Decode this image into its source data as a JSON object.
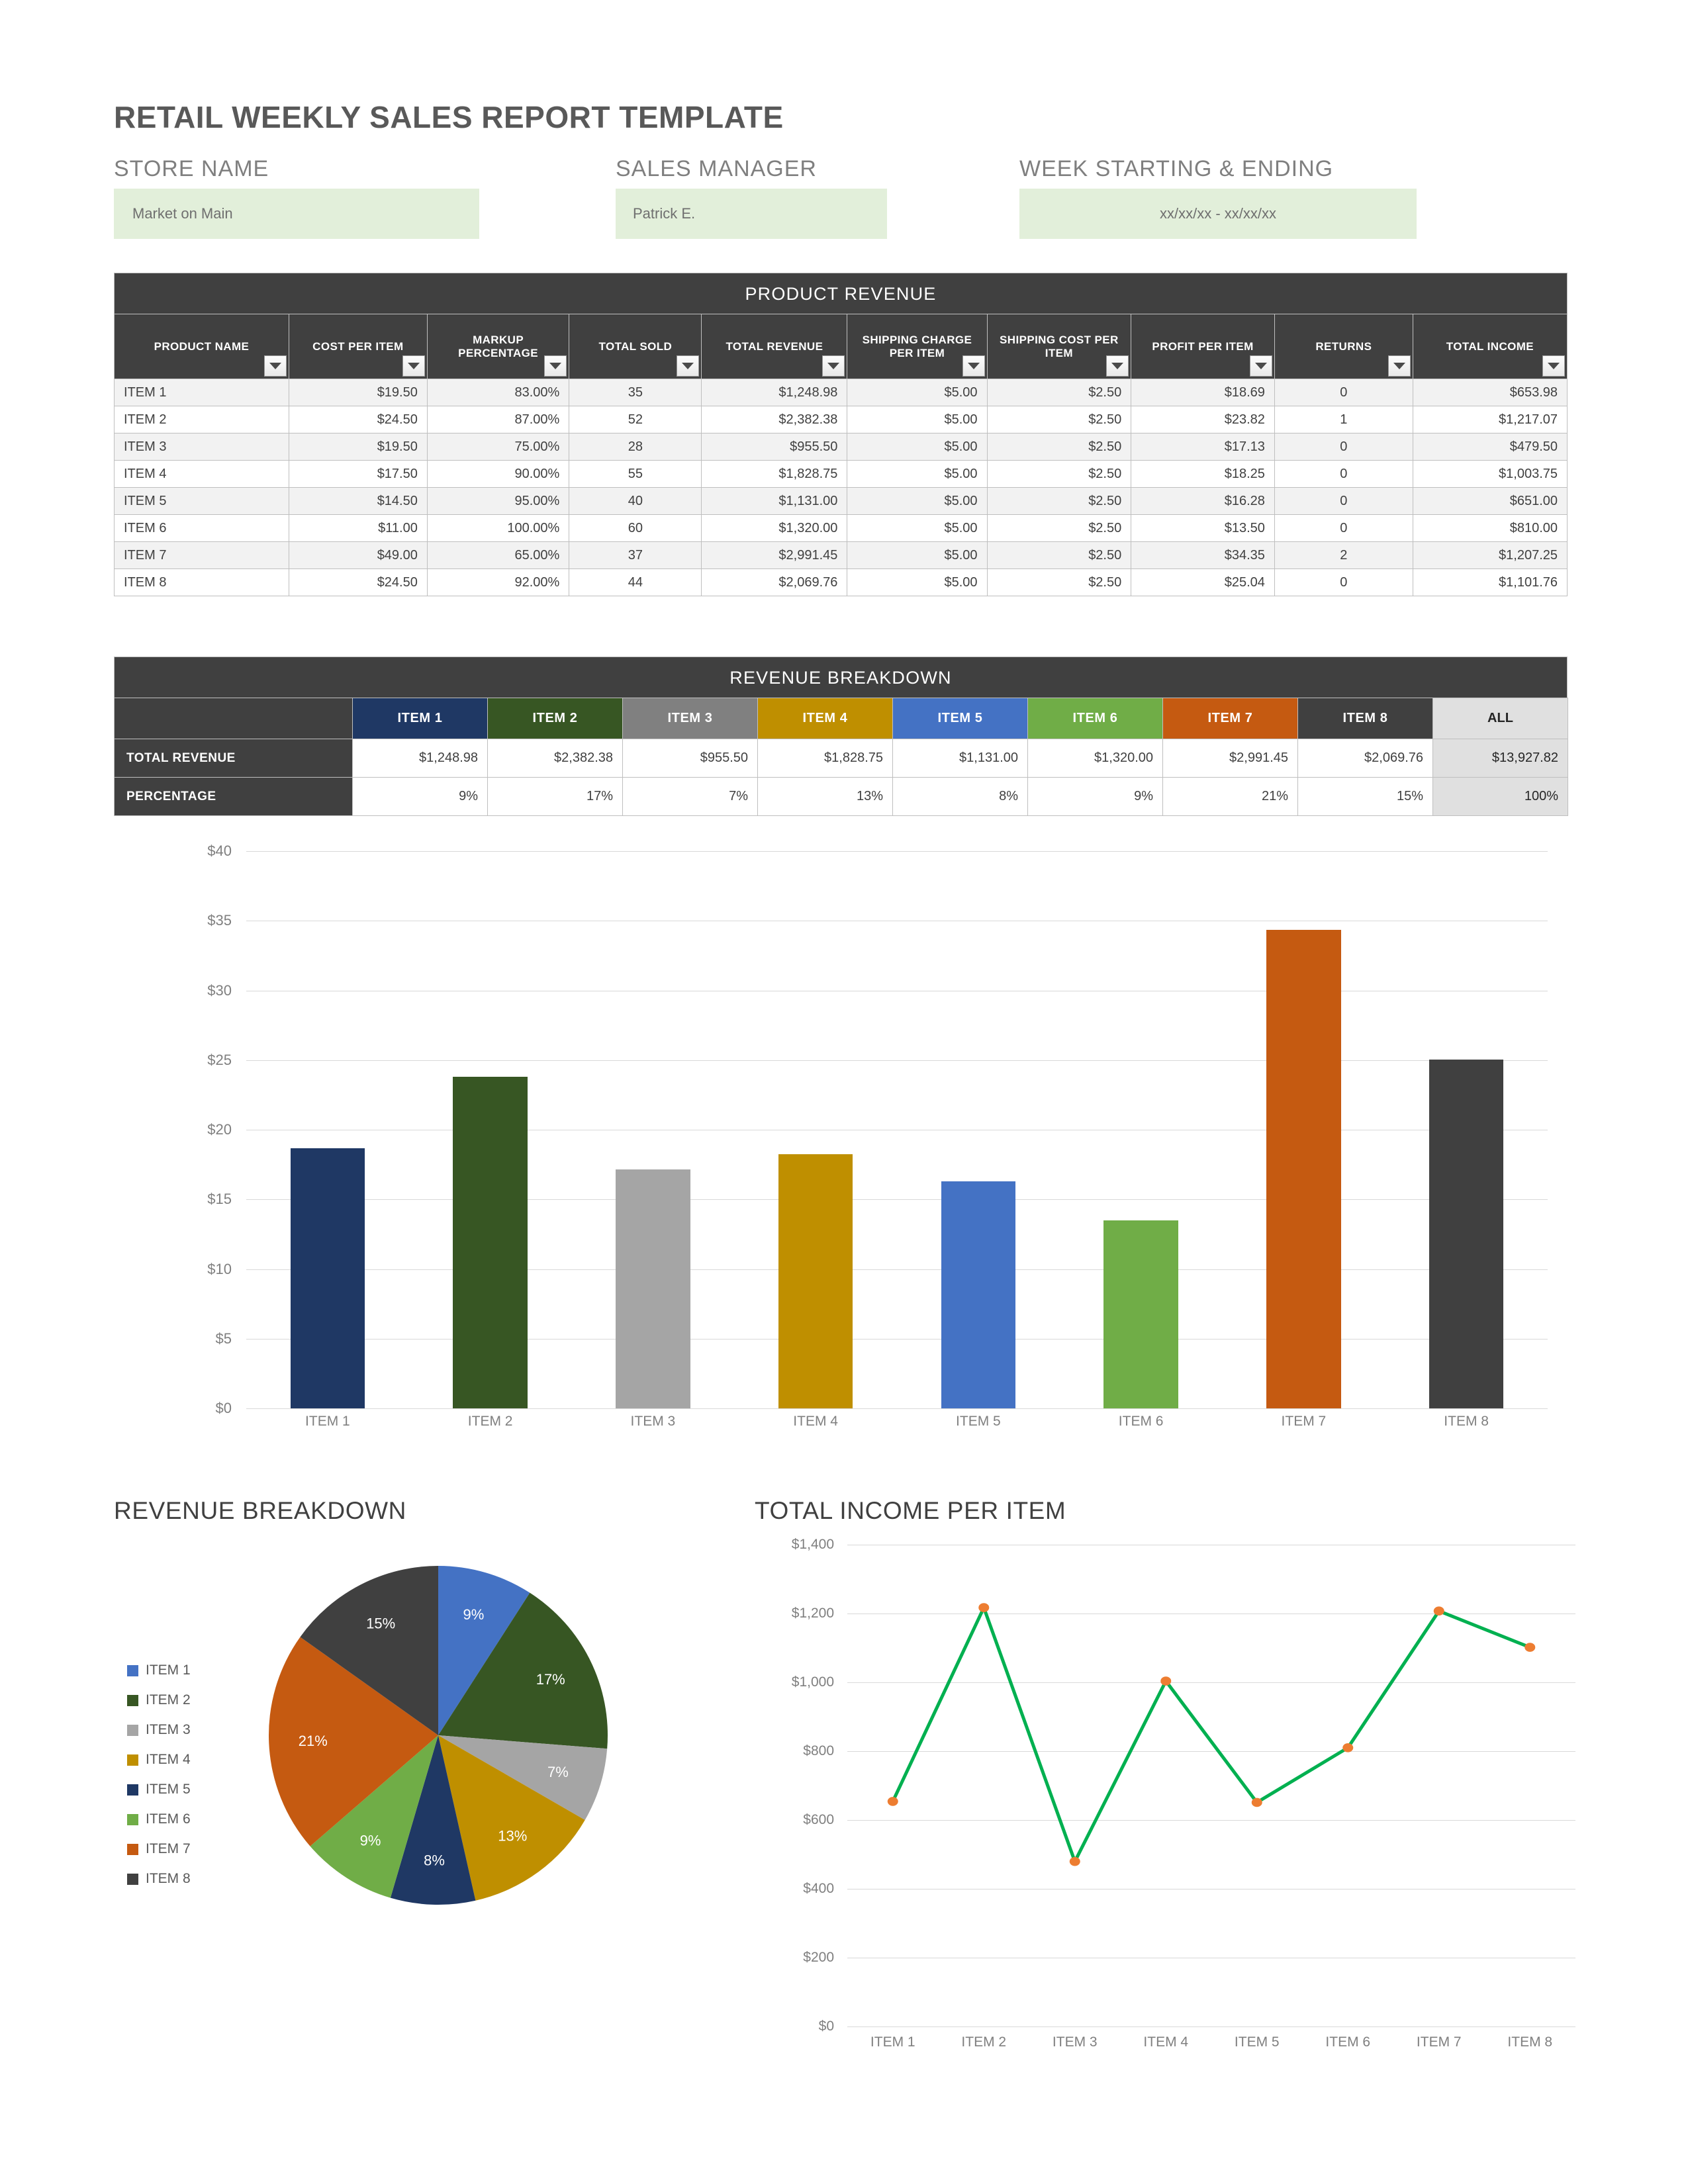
{
  "document": {
    "title": "RETAIL WEEKLY SALES REPORT TEMPLATE"
  },
  "header_fields": {
    "store": {
      "label": "STORE NAME",
      "value": "Market on Main"
    },
    "manager": {
      "label": "SALES MANAGER",
      "value": "Patrick E."
    },
    "week": {
      "label": "WEEK STARTING & ENDING",
      "value": "xx/xx/xx - xx/xx/xx"
    }
  },
  "product_revenue": {
    "band_title": "PRODUCT REVENUE",
    "columns": [
      "PRODUCT NAME",
      "COST PER ITEM",
      "MARKUP PERCENTAGE",
      "TOTAL SOLD",
      "TOTAL REVENUE",
      "SHIPPING CHARGE PER ITEM",
      "SHIPPING COST PER ITEM",
      "PROFIT PER ITEM",
      "RETURNS",
      "TOTAL INCOME"
    ],
    "rows": [
      [
        "ITEM 1",
        "$19.50",
        "83.00%",
        "35",
        "$1,248.98",
        "$5.00",
        "$2.50",
        "$18.69",
        "0",
        "$653.98"
      ],
      [
        "ITEM 2",
        "$24.50",
        "87.00%",
        "52",
        "$2,382.38",
        "$5.00",
        "$2.50",
        "$23.82",
        "1",
        "$1,217.07"
      ],
      [
        "ITEM 3",
        "$19.50",
        "75.00%",
        "28",
        "$955.50",
        "$5.00",
        "$2.50",
        "$17.13",
        "0",
        "$479.50"
      ],
      [
        "ITEM 4",
        "$17.50",
        "90.00%",
        "55",
        "$1,828.75",
        "$5.00",
        "$2.50",
        "$18.25",
        "0",
        "$1,003.75"
      ],
      [
        "ITEM 5",
        "$14.50",
        "95.00%",
        "40",
        "$1,131.00",
        "$5.00",
        "$2.50",
        "$16.28",
        "0",
        "$651.00"
      ],
      [
        "ITEM 6",
        "$11.00",
        "100.00%",
        "60",
        "$1,320.00",
        "$5.00",
        "$2.50",
        "$13.50",
        "0",
        "$810.00"
      ],
      [
        "ITEM 7",
        "$49.00",
        "65.00%",
        "37",
        "$2,991.45",
        "$5.00",
        "$2.50",
        "$34.35",
        "2",
        "$1,207.25"
      ],
      [
        "ITEM 8",
        "$24.50",
        "92.00%",
        "44",
        "$2,069.76",
        "$5.00",
        "$2.50",
        "$25.04",
        "0",
        "$1,101.76"
      ]
    ]
  },
  "revenue_breakdown_table": {
    "band_title": "REVENUE BREAKDOWN",
    "item_headers": [
      "ITEM 1",
      "ITEM 2",
      "ITEM 3",
      "ITEM 4",
      "ITEM 5",
      "ITEM 6",
      "ITEM 7",
      "ITEM 8"
    ],
    "all_header": "ALL",
    "header_colors": [
      "#1F3864",
      "#375623",
      "#808080",
      "#BF8F00",
      "#4472C4",
      "#70AD47",
      "#C55A11",
      "#404040"
    ],
    "rows": [
      {
        "label": "TOTAL REVENUE",
        "values": [
          "$1,248.98",
          "$2,382.38",
          "$955.50",
          "$1,828.75",
          "$1,131.00",
          "$1,320.00",
          "$2,991.45",
          "$2,069.76"
        ],
        "total": "$13,927.82"
      },
      {
        "label": "PERCENTAGE",
        "values": [
          "9%",
          "17%",
          "7%",
          "13%",
          "8%",
          "9%",
          "21%",
          "15%"
        ],
        "total": "100%"
      }
    ]
  },
  "chart_data": [
    {
      "type": "bar",
      "title": "",
      "xlabel": "",
      "ylabel": "",
      "categories": [
        "ITEM 1",
        "ITEM 2",
        "ITEM 3",
        "ITEM 4",
        "ITEM 5",
        "ITEM 6",
        "ITEM 7",
        "ITEM 8"
      ],
      "values": [
        18.69,
        23.82,
        17.13,
        18.25,
        16.28,
        13.5,
        34.35,
        25.04
      ],
      "colors": [
        "#1F3864",
        "#375623",
        "#A5A5A5",
        "#BF8F00",
        "#4472C4",
        "#70AD47",
        "#C55A11",
        "#404040"
      ],
      "ylim": [
        0,
        40
      ],
      "yticks": [
        "$0",
        "$5",
        "$10",
        "$15",
        "$20",
        "$25",
        "$30",
        "$35",
        "$40"
      ],
      "ytick_values": [
        0,
        5,
        10,
        15,
        20,
        25,
        30,
        35,
        40
      ],
      "grid": true,
      "legend": "none"
    },
    {
      "type": "pie",
      "title": "REVENUE BREAKDOWN",
      "labels": [
        "ITEM 1",
        "ITEM 2",
        "ITEM 3",
        "ITEM 4",
        "ITEM 5",
        "ITEM 6",
        "ITEM 7",
        "ITEM 8"
      ],
      "values": [
        9,
        17,
        7,
        13,
        8,
        9,
        21,
        15
      ],
      "data_labels": [
        "9%",
        "17%",
        "7%",
        "13%",
        "8%",
        "9%",
        "21%",
        "15%"
      ],
      "colors": [
        "#4472C4",
        "#375623",
        "#A5A5A5",
        "#BF8F00",
        "#1F3864",
        "#70AD47",
        "#C55A11",
        "#404040"
      ],
      "legend": "left"
    },
    {
      "type": "line",
      "title": "TOTAL INCOME PER ITEM",
      "xlabel": "",
      "ylabel": "",
      "categories": [
        "ITEM 1",
        "ITEM 2",
        "ITEM 3",
        "ITEM 4",
        "ITEM 5",
        "ITEM 6",
        "ITEM 7",
        "ITEM 8"
      ],
      "values": [
        653.98,
        1217.07,
        479.5,
        1003.75,
        651.0,
        810.0,
        1207.25,
        1101.76
      ],
      "ylim": [
        0,
        1400
      ],
      "yticks": [
        "$0",
        "$200",
        "$400",
        "$600",
        "$800",
        "$1,000",
        "$1,200",
        "$1,400"
      ],
      "ytick_values": [
        0,
        200,
        400,
        600,
        800,
        1000,
        1200,
        1400
      ],
      "line_color": "#00B050",
      "marker_color": "#ED7D31",
      "grid": true,
      "legend": "none"
    }
  ],
  "colors": {
    "band_dark": "#404040",
    "input_green": "#E2EFDA",
    "title_gray": "#595959",
    "total_gray": "#E0E0E0"
  },
  "icons": {
    "filter": "filter-dropdown-icon"
  }
}
